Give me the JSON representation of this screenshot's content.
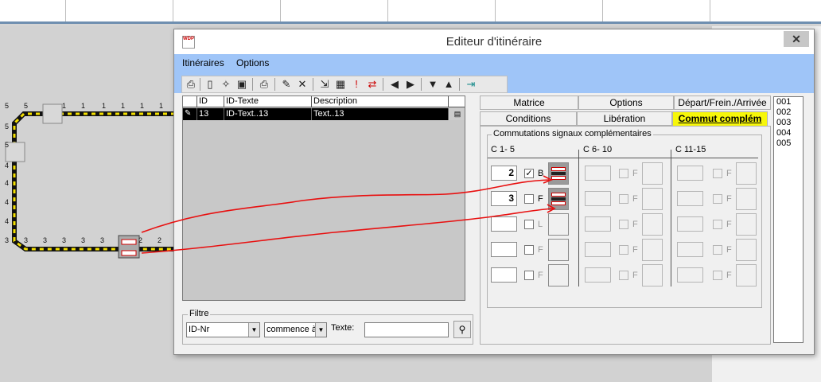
{
  "background": {
    "track_numbers": {
      "top_row": [
        "5",
        "5",
        "1",
        "1",
        "1",
        "1",
        "1",
        "1"
      ],
      "left_col": [
        "5",
        "5",
        "4",
        "4",
        "4",
        "4",
        "3"
      ],
      "bottom_row": [
        "3",
        "3",
        "3",
        "3",
        "3",
        "2",
        "2"
      ]
    }
  },
  "dialog": {
    "title": "Editeur d'itinéraire",
    "icon_label": "WDP",
    "close_label": "✕",
    "menu": [
      "Itinéraires",
      "Options"
    ],
    "grid": {
      "headers": [
        "ID",
        "ID-Texte",
        "Description"
      ],
      "rows": [
        {
          "marker": "✎",
          "id": "13",
          "text": "ID-Text..13",
          "description": "Text..13"
        }
      ]
    },
    "filter": {
      "legend": "Filtre",
      "field_value": "ID-Nr",
      "mode_value": "commence à",
      "text_label": "Texte:",
      "text_value": ""
    },
    "tabs": {
      "row1": [
        "Matrice",
        "Options",
        "Départ/Frein./Arrivée"
      ],
      "row2": [
        "Conditions",
        "Libération",
        "Commut complém"
      ],
      "active": "Commut complém"
    },
    "group": {
      "legend": "Commutations signaux complémentaires",
      "columns": [
        "C 1- 5",
        "C 6- 10",
        "C 11-15"
      ],
      "rows_col1": [
        {
          "value": "2",
          "checked": true,
          "letter": "B"
        },
        {
          "value": "3",
          "checked": false,
          "letter": "F"
        },
        {
          "value": "",
          "checked": false,
          "letter": "L"
        },
        {
          "value": "",
          "checked": false,
          "letter": "F"
        },
        {
          "value": "",
          "checked": false,
          "letter": "F"
        }
      ],
      "disabled_letter": "F"
    },
    "right_list": [
      "001",
      "002",
      "003",
      "004",
      "005"
    ]
  }
}
